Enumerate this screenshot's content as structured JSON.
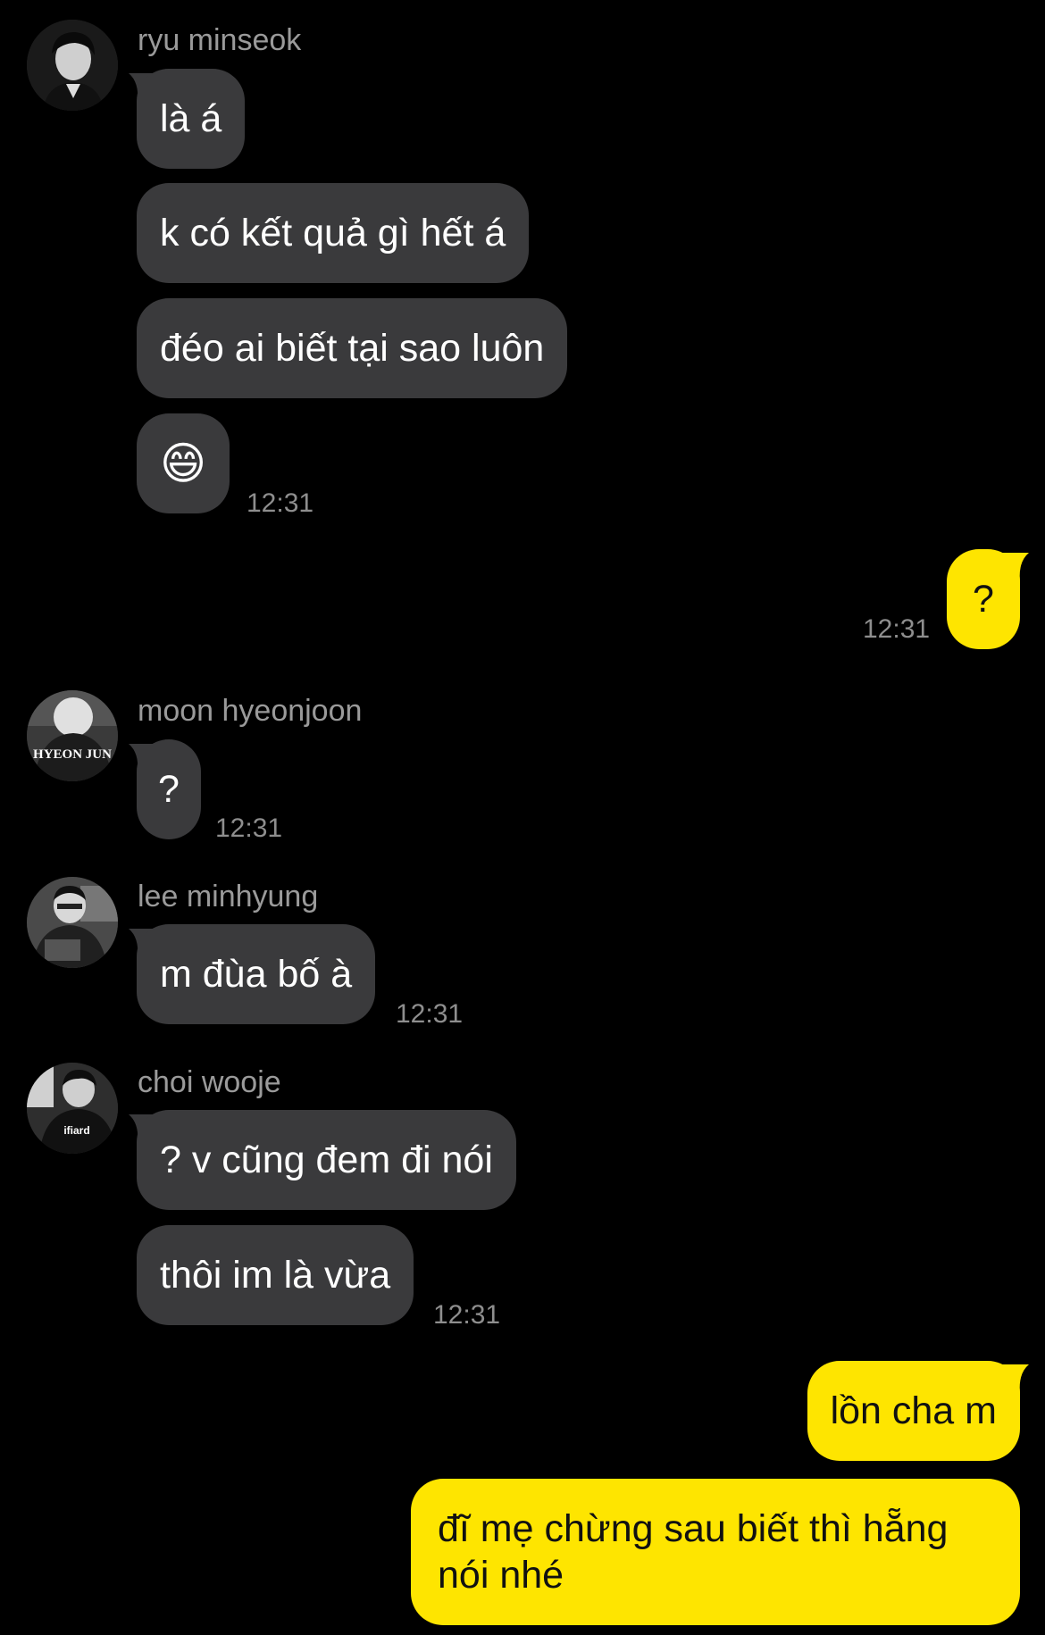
{
  "theme": {
    "background": "#000000",
    "bubble_other": "#3a3a3c",
    "bubble_mine": "#fee500",
    "sender_color": "#9a9a9a",
    "time_color": "#8e8e8e"
  },
  "messages": [
    {
      "sender": "ryu minseok",
      "avatar": "avatar-ryu-minseok",
      "bubbles": [
        "là á",
        "k có kết quả gì hết á",
        "đéo ai biết tại sao luôn",
        "😄"
      ],
      "time": "12:31"
    },
    {
      "mine": true,
      "bubbles": [
        "?"
      ],
      "time": "12:31"
    },
    {
      "sender": "moon hyeonjoon",
      "avatar": "avatar-moon-hyeonjoon",
      "avatar_text": "HYEON JUN",
      "bubbles": [
        "?"
      ],
      "time": "12:31"
    },
    {
      "sender": "lee minhyung",
      "avatar": "avatar-lee-minhyung",
      "bubbles": [
        "m đùa bố à"
      ],
      "time": "12:31"
    },
    {
      "sender": "choi wooje",
      "avatar": "avatar-choi-wooje",
      "bubbles": [
        "? v cũng đem đi nói",
        "thôi im là vừa"
      ],
      "time": "12:31"
    },
    {
      "mine": true,
      "bubbles": [
        "lồn cha m",
        "đĩ mẹ chừng sau biết thì hẵng nói nhé"
      ]
    }
  ]
}
